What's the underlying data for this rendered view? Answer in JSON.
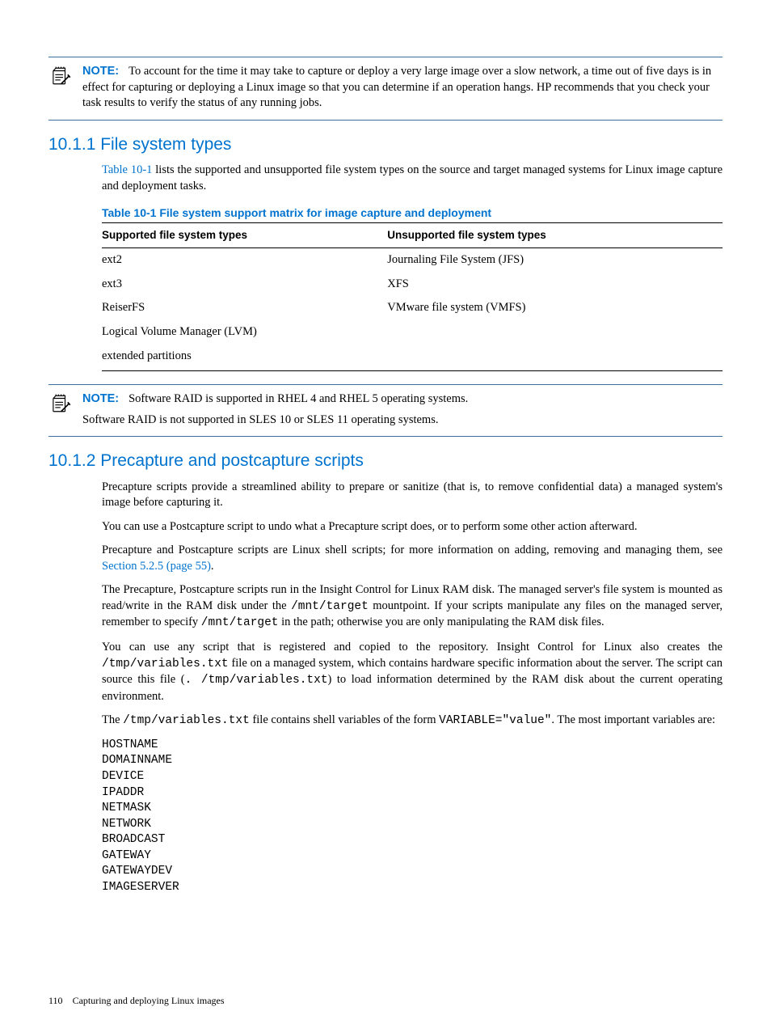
{
  "note1": {
    "label": "NOTE:",
    "text": "To account for the time it may take to capture or deploy a very large image over a slow network, a time out of five days is in effect for capturing or deploying a Linux image so that you can determine if an operation hangs. HP recommends that you check your task results to verify the status of any running jobs."
  },
  "section1": {
    "heading": "10.1.1 File system types",
    "intro_before_link": "",
    "link1": "Table 10-1",
    "intro_after_link": " lists the supported and unsupported file system types on the source and target managed systems for Linux image capture and deployment tasks.",
    "table_caption": "Table 10-1 File system support matrix for image capture and deployment",
    "table": {
      "headers": [
        "Supported file system types",
        "Unsupported file system types"
      ],
      "rows": [
        [
          "ext2",
          "Journaling File System (JFS)"
        ],
        [
          "ext3",
          "XFS"
        ],
        [
          "ReiserFS",
          "VMware file system (VMFS)"
        ],
        [
          "Logical Volume Manager (LVM)",
          ""
        ],
        [
          "extended partitions",
          ""
        ]
      ]
    }
  },
  "note2": {
    "label": "NOTE:",
    "line1": "Software RAID is supported in RHEL 4 and RHEL 5 operating systems.",
    "line2": "Software RAID is not supported in SLES 10 or SLES 11 operating systems."
  },
  "section2": {
    "heading": "10.1.2 Precapture and postcapture scripts",
    "p1": "Precapture scripts provide a streamlined ability to prepare or sanitize (that is, to remove confidential data) a managed system's image before capturing it.",
    "p2": "You can use a Postcapture script to undo what a Precapture script does, or to perform some other action afterward.",
    "p3_before": "Precapture and Postcapture scripts are Linux shell scripts; for more information on adding, removing and managing them, see ",
    "p3_link": "Section 5.2.5 (page 55)",
    "p3_after": ".",
    "p4_a": "The Precapture, Postcapture scripts run in the Insight Control for Linux RAM disk. The managed server's file system is mounted as read/write in the RAM disk under the ",
    "p4_m1": "/mnt/target",
    "p4_b": " mountpoint. If your scripts manipulate any files on the managed server, remember to specify ",
    "p4_m2": "/mnt/target",
    "p4_c": " in the path; otherwise you are only manipulating the RAM disk files.",
    "p5_a": "You can use any script that is registered and copied to the repository. Insight Control for Linux also creates the ",
    "p5_m1": "/tmp/variables.txt",
    "p5_b": " file on a managed system, which contains hardware specific information about the server. The script can source this file (",
    "p5_m2": ". /tmp/variables.txt",
    "p5_c": ") to load information determined by the RAM disk about the current operating environment.",
    "p6_a": "The ",
    "p6_m1": "/tmp/variables.txt",
    "p6_b": " file contains shell variables of the form ",
    "p6_m2": "VARIABLE=\"value\"",
    "p6_c": ". The most important variables are:",
    "vars": "HOSTNAME\nDOMAINNAME\nDEVICE\nIPADDR\nNETMASK\nNETWORK\nBROADCAST\nGATEWAY\nGATEWAYDEV\nIMAGESERVER"
  },
  "footer": {
    "page": "110",
    "title": "Capturing and deploying Linux images"
  }
}
